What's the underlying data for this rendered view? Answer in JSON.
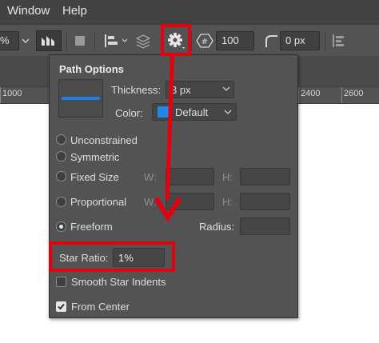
{
  "menubar": {
    "items": [
      "Window",
      "Help"
    ]
  },
  "toolbar": {
    "zoom_fragment": "%",
    "corners_value": "100",
    "radius_value": "0 px"
  },
  "ruler": {
    "ticks": [
      "1000",
      "2400",
      "2600"
    ]
  },
  "path_options": {
    "title": "Path Options",
    "thickness_label": "Thickness:",
    "thickness_value": "3 px",
    "color_label": "Color:",
    "color_value": "Default",
    "color_swatch": "#1e88e5",
    "preview_line_color": "#1e7fe0",
    "options": {
      "unconstrained": "Unconstrained",
      "symmetric": "Symmetric",
      "fixed_size": "Fixed Size",
      "proportional": "Proportional",
      "freeform": "Freeform",
      "selected": "freeform"
    },
    "w_label": "W:",
    "h_label": "H:",
    "radius_label": "Radius:",
    "star_ratio_label": "Star Ratio:",
    "star_ratio_value": "1%",
    "smooth_star_indents_label": "Smooth Star Indents",
    "smooth_star_indents_checked": false,
    "from_center_label": "From Center",
    "from_center_checked": true
  },
  "annotation": {
    "highlight_color": "#e3000f"
  }
}
